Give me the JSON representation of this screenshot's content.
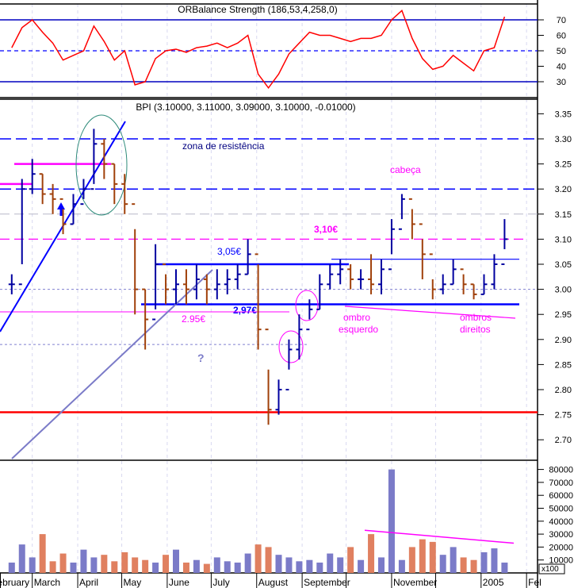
{
  "chart_data": [
    {
      "type": "line",
      "title": "ORBalance Strength (186,53,4,258,0)",
      "ylim": [
        20,
        80
      ],
      "yticks": [
        30,
        40,
        50,
        60,
        70
      ],
      "reference_levels": {
        "upper": 70,
        "middle": 50,
        "lower": 30
      },
      "x_start": "2004-02-16",
      "x_frequency": "weekly",
      "series": [
        {
          "values": [
            52,
            65,
            70,
            62,
            55,
            44,
            47,
            50,
            66,
            56,
            44,
            50,
            28,
            30,
            45,
            50,
            51,
            49,
            52,
            53,
            55,
            52,
            55,
            60,
            35,
            26,
            35,
            48,
            55,
            62,
            60,
            60,
            58,
            56,
            58,
            58,
            60,
            70,
            76,
            58,
            45,
            38,
            40,
            47,
            42,
            37,
            50,
            52,
            72
          ],
          "color": "#ff0000"
        }
      ],
      "grid": true
    },
    {
      "type": "ohlc",
      "title": "BPI (3.10000, 3.11000, 3.09000, 3.10000, -0.01000)",
      "ylim": [
        2.66,
        3.38
      ],
      "yticks": [
        "3.35",
        "3.30",
        "3.25",
        "3.20",
        "3.15",
        "3.10",
        "3.05",
        "3.00",
        "2.95",
        "2.90",
        "2.85",
        "2.80",
        "2.75",
        "2.70"
      ],
      "x_start": "2004-02-16",
      "x_frequency": "weekly",
      "close": [
        3.01,
        3.2,
        3.23,
        3.19,
        3.18,
        3.13,
        3.17,
        3.2,
        3.29,
        3.25,
        3.21,
        3.17,
        3.0,
        2.94,
        3.05,
        3.0,
        3.01,
        3.0,
        3.02,
        3.0,
        3.01,
        3.02,
        3.03,
        3.07,
        2.92,
        2.76,
        2.8,
        2.88,
        2.92,
        2.96,
        3.01,
        3.03,
        3.04,
        3.02,
        3.02,
        3.01,
        3.04,
        3.12,
        3.18,
        3.13,
        3.07,
        3.0,
        3.01,
        3.04,
        3.01,
        2.99,
        3.01,
        3.05,
        3.1
      ],
      "high": [
        3.03,
        3.22,
        3.26,
        3.23,
        3.21,
        3.16,
        3.19,
        3.22,
        3.32,
        3.3,
        3.25,
        3.23,
        3.12,
        3.0,
        3.09,
        3.03,
        3.04,
        3.04,
        3.05,
        3.03,
        3.04,
        3.04,
        3.05,
        3.1,
        3.05,
        2.84,
        2.82,
        2.9,
        2.95,
        2.98,
        3.03,
        3.05,
        3.06,
        3.05,
        3.04,
        3.07,
        3.06,
        3.14,
        3.19,
        3.16,
        3.1,
        3.02,
        3.03,
        3.06,
        3.03,
        3.01,
        3.03,
        3.07,
        3.14
      ],
      "low": [
        2.99,
        3.05,
        3.19,
        3.17,
        3.15,
        3.11,
        3.13,
        3.18,
        3.21,
        3.22,
        3.17,
        3.15,
        2.95,
        2.88,
        2.96,
        2.97,
        2.97,
        2.97,
        2.98,
        2.97,
        2.98,
        2.99,
        3.0,
        3.03,
        2.88,
        2.73,
        2.75,
        2.84,
        2.86,
        2.94,
        2.96,
        3.0,
        3.01,
        3.0,
        3.0,
        2.99,
        2.99,
        3.07,
        3.14,
        3.1,
        3.02,
        2.98,
        2.99,
        3.01,
        2.99,
        2.98,
        2.99,
        3.0,
        3.08
      ],
      "colors": {
        "up": "#0000a0",
        "down": "#a0400a"
      },
      "grid": true,
      "annotations": {
        "resistance_levels": [
          3.3,
          3.2
        ],
        "resistance_label": "zona de resistência",
        "level_310": {
          "value": 3.1,
          "label": "3,10€",
          "color": "#ff00ff"
        },
        "level_305": {
          "value": 3.05,
          "label": "3,05€",
          "color": "#0000ff"
        },
        "level_297": {
          "value": 2.97,
          "label": "2,97€",
          "color": "#0000ff"
        },
        "level_295": {
          "value": 2.955,
          "label": "2.95€",
          "color": "#ff00ff"
        },
        "level_306": {
          "value": 3.06,
          "color": "#0000ff"
        },
        "level_325": {
          "value": 3.25,
          "color": "#ff00ff"
        },
        "level_321": {
          "value": 3.21,
          "color": "#ff00ff"
        },
        "support_level": {
          "value": 2.755,
          "color": "#ff0000"
        },
        "gray_level": 3.15,
        "dotted_levels": [
          3.0,
          2.89
        ],
        "head_label": "cabeça",
        "left_shoulder_label": [
          "ombro",
          "esquerdo"
        ],
        "right_shoulders_label": [
          "ombros",
          "direitos"
        ],
        "question_mark": "?"
      }
    },
    {
      "type": "bar",
      "ylabel_unit": "x100",
      "ylim": [
        0,
        85000
      ],
      "yticks": [
        "80000",
        "70000",
        "60000",
        "50000",
        "40000",
        "30000",
        "20000",
        "10000"
      ],
      "x_start": "2004-02-16",
      "x_frequency": "weekly",
      "values": [
        8000,
        22000,
        12000,
        30000,
        9000,
        15000,
        8000,
        18000,
        12000,
        14000,
        9000,
        16000,
        12000,
        10000,
        8000,
        14000,
        18000,
        8000,
        10000,
        7000,
        12000,
        9000,
        8000,
        15000,
        22000,
        20000,
        14000,
        12000,
        9000,
        10000,
        8000,
        15000,
        12000,
        20000,
        10000,
        30000,
        12000,
        80000,
        10000,
        20000,
        26000,
        24000,
        14000,
        20000,
        12000,
        10000,
        16000,
        19000,
        8000
      ],
      "colors": {
        "up": "#7b7bc8",
        "down": "#e08060"
      },
      "trendline": {
        "from": 33000,
        "to": 23000,
        "color": "#ff00ff"
      }
    }
  ],
  "x_axis": {
    "xlim": [
      "2004-02-08",
      "2005-02-09"
    ],
    "months": [
      {
        "date": "2004-02-01",
        "label": "February"
      },
      {
        "date": "2004-03-01",
        "label": "March"
      },
      {
        "date": "2004-04-01",
        "label": "April"
      },
      {
        "date": "2004-05-01",
        "label": "May"
      },
      {
        "date": "2004-06-01",
        "label": "June"
      },
      {
        "date": "2004-07-01",
        "label": "July"
      },
      {
        "date": "2004-08-01",
        "label": "August"
      },
      {
        "date": "2004-09-01",
        "label": "September"
      },
      {
        "date": "2004-10-01",
        "label": ""
      },
      {
        "date": "2004-11-01",
        "label": "November"
      },
      {
        "date": "2004-12-01",
        "label": ""
      },
      {
        "date": "2005-01-01",
        "label": "2005"
      },
      {
        "date": "2005-02-01",
        "label": "Fel"
      }
    ]
  }
}
